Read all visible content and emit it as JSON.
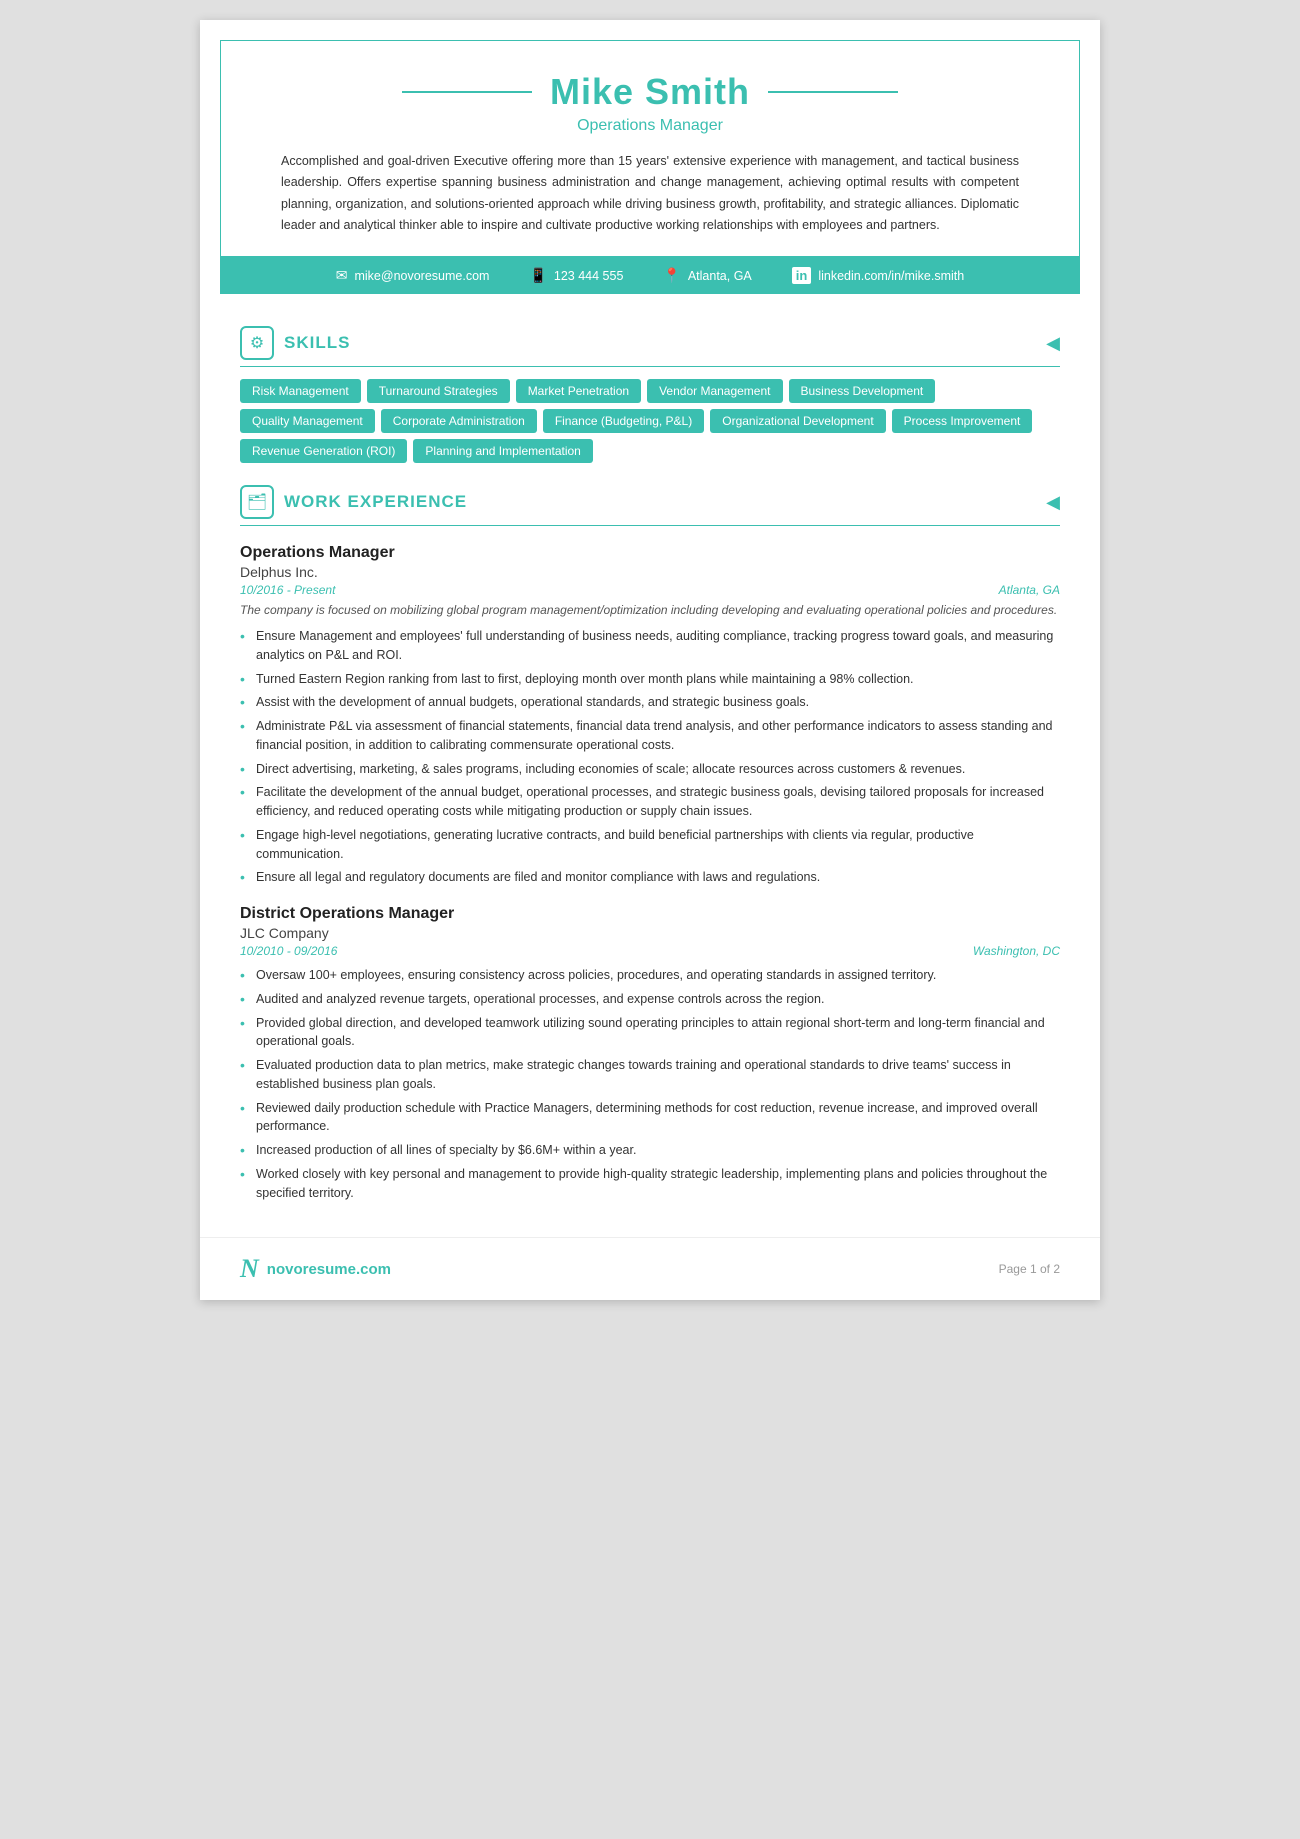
{
  "header": {
    "name": "Mike Smith",
    "job_title": "Operations Manager",
    "summary": "Accomplished and goal-driven Executive offering more than 15 years' extensive experience with management, and tactical business leadership. Offers expertise spanning business administration and change management, achieving optimal results with competent planning, organization, and solutions-oriented approach while driving business growth, profitability, and strategic alliances. Diplomatic leader and analytical thinker able to inspire and cultivate productive working relationships with employees and partners."
  },
  "contact": {
    "email": "mike@novoresume.com",
    "phone": "123 444 555",
    "location": "Atlanta, GA",
    "linkedin": "linkedin.com/in/mike.smith"
  },
  "skills": {
    "section_title": "SKILLS",
    "tags": [
      "Risk Management",
      "Turnaround Strategies",
      "Market Penetration",
      "Vendor Management",
      "Business Development",
      "Quality Management",
      "Corporate Administration",
      "Finance (Budgeting, P&L)",
      "Organizational Development",
      "Process Improvement",
      "Revenue Generation (ROI)",
      "Planning and Implementation"
    ]
  },
  "work_experience": {
    "section_title": "WORK EXPERIENCE",
    "jobs": [
      {
        "title": "Operations Manager",
        "company": "Delphus Inc.",
        "dates": "10/2016 - Present",
        "location": "Atlanta, GA",
        "description": "The company is focused on mobilizing global program management/optimization including developing and evaluating operational policies and procedures.",
        "bullets": [
          "Ensure Management and employees' full understanding of business needs, auditing compliance, tracking progress toward goals, and measuring analytics on P&L and ROI.",
          "Turned Eastern Region ranking from last to first, deploying month over month plans while maintaining a 98% collection.",
          "Assist with the development of annual budgets, operational standards, and strategic business goals.",
          "Administrate P&L via assessment of financial statements, financial data trend analysis, and other performance indicators to assess standing and financial position, in addition to calibrating commensurate operational costs.",
          "Direct advertising, marketing, & sales programs, including economies of scale; allocate resources across customers & revenues.",
          "Facilitate the development of the annual budget, operational processes, and strategic business goals, devising tailored proposals for increased efficiency, and reduced operating costs while mitigating production or supply chain issues.",
          "Engage high-level negotiations, generating lucrative contracts, and build beneficial partnerships with clients via regular, productive communication.",
          "Ensure all legal and regulatory documents are filed and monitor compliance with laws and regulations."
        ]
      },
      {
        "title": "District Operations Manager",
        "company": "JLC Company",
        "dates": "10/2010 - 09/2016",
        "location": "Washington, DC",
        "description": "",
        "bullets": [
          "Oversaw 100+ employees, ensuring consistency across policies, procedures, and operating standards in assigned territory.",
          "Audited and analyzed revenue targets, operational processes, and expense controls across the region.",
          "Provided global direction, and developed teamwork utilizing sound operating principles to attain regional short-term and long-term financial and operational goals.",
          "Evaluated production data to plan metrics, make strategic changes towards training and operational standards to drive teams' success in established business plan goals.",
          "Reviewed daily production schedule with Practice Managers, determining methods for cost reduction, revenue increase, and improved overall performance.",
          "Increased production of all lines of specialty by $6.6M+ within a year.",
          "Worked closely with key personal and management to provide high-quality strategic leadership, implementing plans and policies throughout the specified territory."
        ]
      }
    ]
  },
  "footer": {
    "brand": "novoresume.com",
    "page": "Page 1 of 2"
  }
}
